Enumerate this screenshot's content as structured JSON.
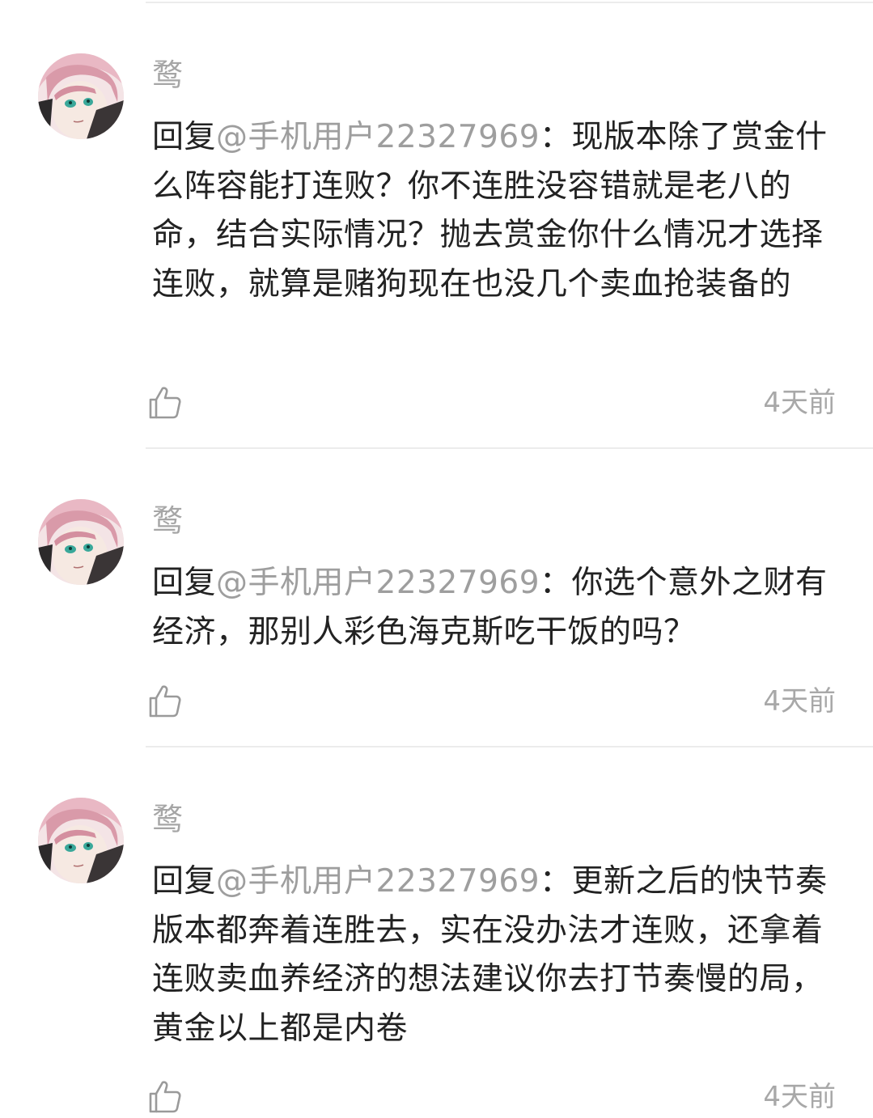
{
  "comments": [
    {
      "username": "鹜",
      "reply_prefix": "回复",
      "mention": "@手机用户22327969",
      "text": "：现版本除了赏金什么阵容能打连败？你不连胜没容错就是老八的命，结合实际情况？抛去赏金你什么情况才选择连败，就算是赌狗现在也没几个卖血抢装备的",
      "time": "4天前",
      "like_icon": "thumbs-up-icon"
    },
    {
      "username": "鹜",
      "reply_prefix": "回复",
      "mention": "@手机用户22327969",
      "text": "：你选个意外之财有经济，那别人彩色海克斯吃干饭的吗？",
      "time": "4天前",
      "like_icon": "thumbs-up-icon"
    },
    {
      "username": "鹜",
      "reply_prefix": "回复",
      "mention": "@手机用户22327969",
      "text": "：更新之后的快节奏版本都奔着连胜去，实在没办法才连败，还拿着连败卖血养经济的想法建议你去打节奏慢的局，黄金以上都是内卷",
      "time": "4天前",
      "like_icon": "thumbs-up-icon"
    }
  ],
  "colors": {
    "username": "#a6a6a6",
    "mention": "#9e9e9e",
    "body": "#222222",
    "time": "#a8a8a8",
    "divider": "#ececec"
  }
}
